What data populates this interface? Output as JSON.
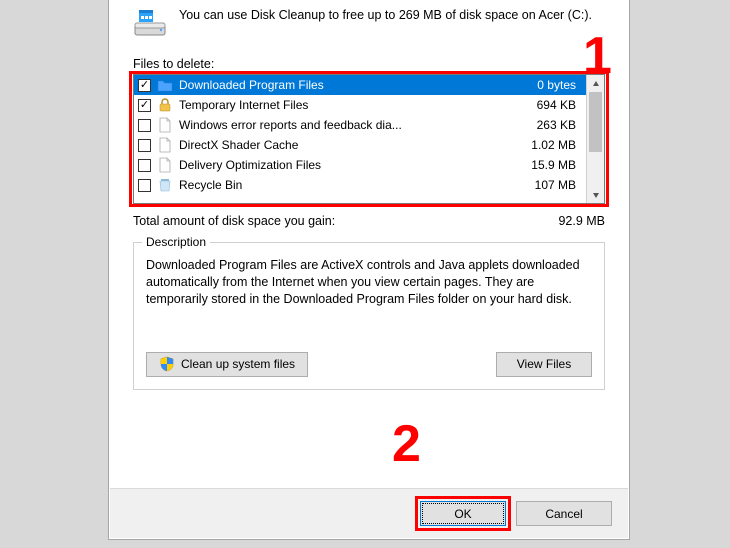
{
  "intro": "You can use Disk Cleanup to free up to 269 MB of disk space on Acer (C:).",
  "files_label": "Files to delete:",
  "rows": [
    {
      "name": "Downloaded Program Files",
      "size": "0 bytes",
      "checked": true,
      "selected": true,
      "icon": "folder"
    },
    {
      "name": "Temporary Internet Files",
      "size": "694 KB",
      "checked": true,
      "selected": false,
      "icon": "lock"
    },
    {
      "name": "Windows error reports and feedback dia...",
      "size": "263 KB",
      "checked": false,
      "selected": false,
      "icon": "file"
    },
    {
      "name": "DirectX Shader Cache",
      "size": "1.02 MB",
      "checked": false,
      "selected": false,
      "icon": "file"
    },
    {
      "name": "Delivery Optimization Files",
      "size": "15.9 MB",
      "checked": false,
      "selected": false,
      "icon": "file"
    },
    {
      "name": "Recycle Bin",
      "size": "107 MB",
      "checked": false,
      "selected": false,
      "icon": "bin"
    }
  ],
  "total_label": "Total amount of disk space you gain:",
  "total_value": "92.9 MB",
  "group_title": "Description",
  "description": "Downloaded Program Files are ActiveX controls and Java applets downloaded automatically from the Internet when you view certain pages. They are temporarily stored in the Downloaded Program Files folder on your hard disk.",
  "btn_cleanup": "Clean up system files",
  "btn_view": "View Files",
  "btn_ok": "OK",
  "btn_cancel": "Cancel",
  "anno1": "1",
  "anno2": "2"
}
